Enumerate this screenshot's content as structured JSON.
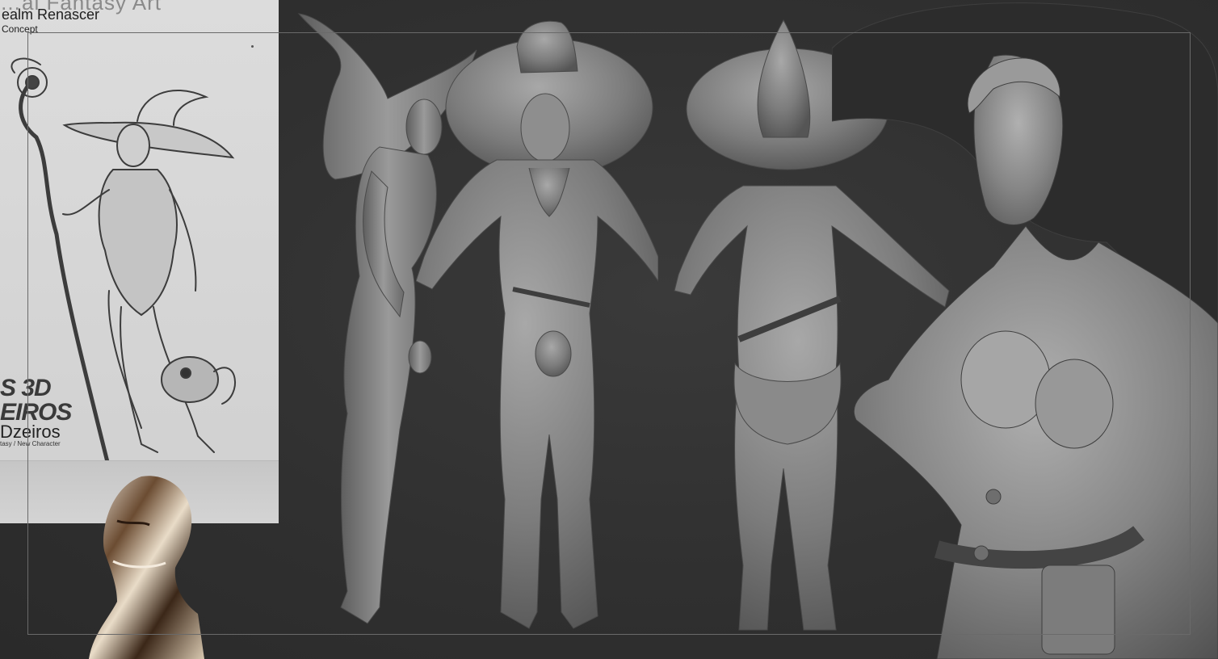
{
  "reference": {
    "title": "…al Fantasy Art",
    "subtitle": "ealm Renascer",
    "caption": "Concept",
    "logo_line1": "S 3D",
    "logo_line2": "EIROS",
    "author": "Dzeiros",
    "tagline": "tasy / New Character"
  },
  "colors": {
    "background": "#2f2f2f",
    "clay": "#8c8c8c",
    "reference_bg": "#d6d6d6",
    "frame": "#6a6a6a"
  }
}
